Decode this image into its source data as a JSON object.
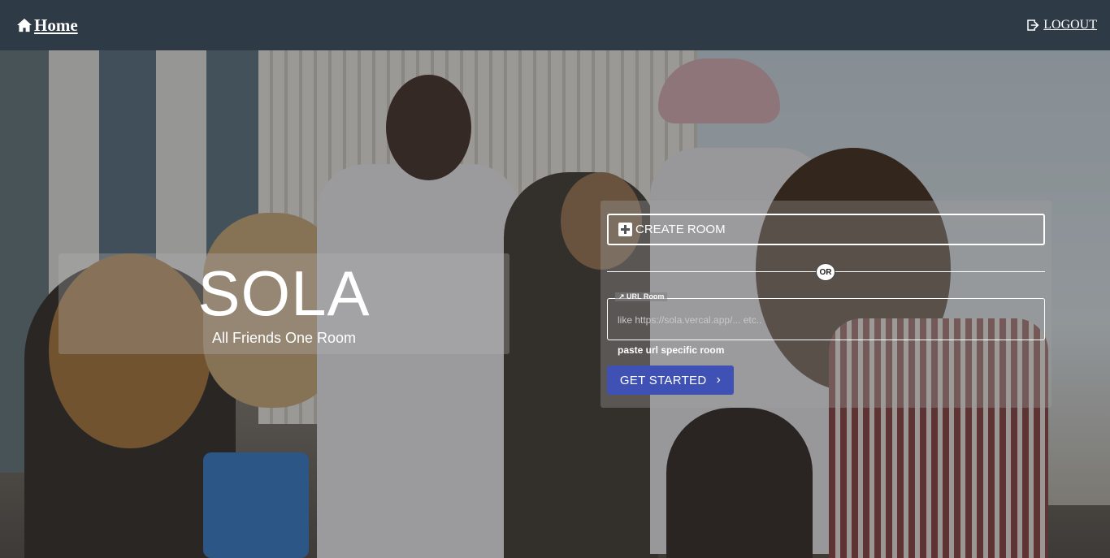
{
  "header": {
    "home_label": "Home",
    "logout_label": "LOGOUT",
    "home_icon": "home-icon",
    "logout_icon": "logout-icon"
  },
  "hero": {
    "title": "SOLA",
    "tagline": "All Friends One Room"
  },
  "form": {
    "create_room_label": "CREATE ROOM",
    "create_room_icon": "plus-box-icon",
    "or_label": "OR",
    "url_legend": "↗ URL Room",
    "url_placeholder": "like https://sola.vercal.app/... etc..",
    "url_value": "",
    "helper_text": "paste url specific room",
    "get_started_label": "GET STARTED",
    "get_started_icon": "chevron-right-icon"
  },
  "colors": {
    "header_bg": "#2e3b47",
    "primary_button": "#3f51b5"
  }
}
